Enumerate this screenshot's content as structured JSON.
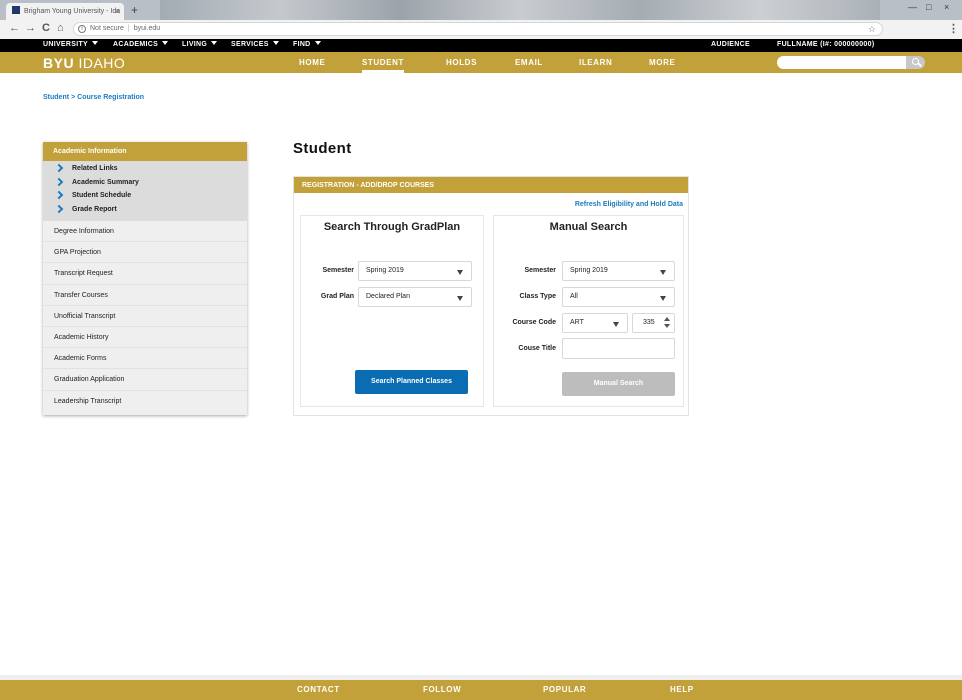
{
  "browser": {
    "tab_title": "Brigham Young University - Ida",
    "tab_close": "×",
    "new_tab": "+",
    "back": "←",
    "forward": "→",
    "reload": "C",
    "home": "⌂",
    "security": "Not secure",
    "url": "byui.edu",
    "bookmark": "☆",
    "menu": "⋮",
    "win_minimize": "—",
    "win_maximize": "□",
    "win_close": "×"
  },
  "topnav": {
    "items": [
      "UNIVERSITY",
      "ACADEMICS",
      "LIVING",
      "SERVICES",
      "FIND"
    ],
    "audience": "AUDIENCE",
    "fullname": "FULLNAME (I#: 000000000)"
  },
  "header": {
    "logo_bold": "BYU",
    "logo_rest": "IDAHO",
    "nav": [
      "HOME",
      "STUDENT",
      "HOLDS",
      "EMAIL",
      "ILEARN",
      "MORE"
    ],
    "active_nav": "STUDENT",
    "search_value": ""
  },
  "breadcrumb": {
    "items": [
      "Student",
      "Course Registration"
    ],
    "separator": ">"
  },
  "sidebar": {
    "heading": "Academic Information",
    "subitems": [
      "Related Links",
      "Academic Summary",
      "Student Schedule",
      "Grade Report"
    ],
    "items": [
      "Degree Information",
      "GPA Projection",
      "Transcript Request",
      "Transfer Courses",
      "Unofficial Transcript",
      "Academic History",
      "Academic Forms",
      "Graduation Application",
      "Leadership Transcript"
    ]
  },
  "main": {
    "title": "Student",
    "panel_title": "REGISTRATION - ADD/DROP COURSES",
    "refresh_link": "Refresh Eligibility and Hold Data",
    "gradplan": {
      "title": "Search Through GradPlan",
      "semester_label": "Semester",
      "semester_value": "Spring 2019",
      "gradplan_label": "Grad Plan",
      "gradplan_value": "Declared Plan",
      "button": "Search Planned Classes"
    },
    "manual": {
      "title": "Manual Search",
      "semester_label": "Semester",
      "semester_value": "Spring 2019",
      "classtype_label": "Class Type",
      "classtype_value": "All",
      "coursecode_label": "Course Code",
      "subject_value": "ART",
      "number_value": "335",
      "coursetitle_label": "Couse Title",
      "coursetitle_value": "",
      "button": "Manual Search"
    }
  },
  "footer": {
    "items": [
      "CONTACT",
      "FOLLOW",
      "POPULAR",
      "HELP"
    ]
  },
  "colors": {
    "gold": "#c2a03a",
    "blue_link": "#1a7cc1",
    "blue_button": "#0a6db3",
    "disabled_button": "#bdbdbd"
  }
}
